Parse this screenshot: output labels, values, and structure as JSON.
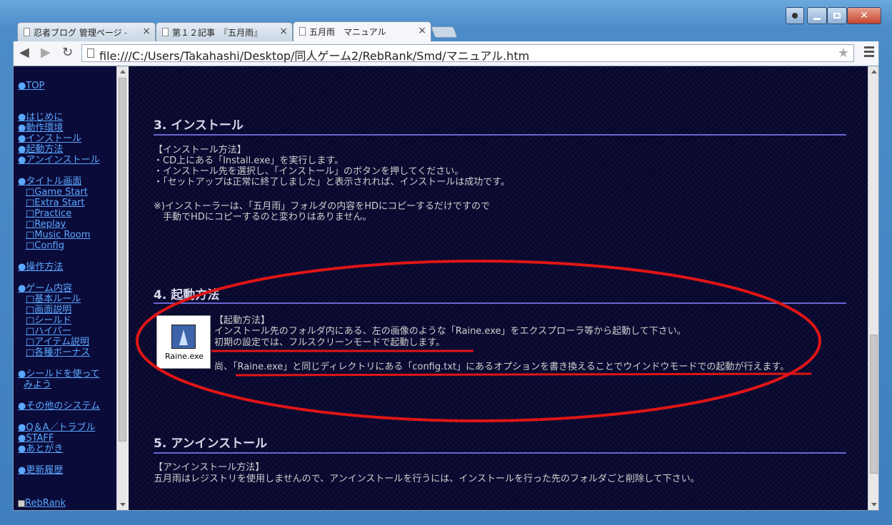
{
  "tabs": [
    {
      "label": "忍者ブログ 管理ページ - "
    },
    {
      "label": "第１２記事　『五月雨』"
    },
    {
      "label": "五月雨　マニュアル"
    }
  ],
  "address": {
    "url": "file:///C:/Users/Takahashi/Desktop/同人ゲーム2/RebRank/Smd/マニュアル.htm"
  },
  "sidebar": {
    "top": "●TOP",
    "items": [
      "●はじめに",
      "●動作環境",
      "●インストール",
      "●起動方法",
      "●アンインストール",
      "●タイトル画面",
      "□Game Start",
      "□Extra Start",
      "□Practice",
      "□Replay",
      "□Music Room",
      "□Config",
      "●操作方法",
      "●ゲーム内容",
      "□基本ルール",
      "□画面説明",
      "□シールド",
      "□ハイパー",
      "□アイテム説明",
      "□各種ボーナス",
      "●シールドを使って",
      "みよう",
      "●その他のシステム",
      "●Q＆A／トラブル",
      "●STAFF",
      "●あとがき",
      "●更新履歴",
      "RebRank"
    ]
  },
  "sections": {
    "install": {
      "title": "3. インストール",
      "heading": "【インストール方法】",
      "lines": [
        "・CD上にある「Install.exe」を実行します。",
        "・インストール先を選択し、「インストール」のボタンを押してください。",
        "・「セットアップは正常に終了しました」と表示されれば、インストールは成功です。"
      ],
      "note1": "※)インストーラーは、「五月雨」フォルダの内容をHDにコピーするだけですので",
      "note2": "　手動でHDにコピーするのと変わりはありません。"
    },
    "launch": {
      "title": "4. 起動方法",
      "heading": "【起動方法】",
      "line1": "インストール先のフォルダ内にある、左の画像のような「Raine.exe」をエクスプローラ等から起動して下さい。",
      "line2": "初期の設定では、フルスクリーンモードで起動します。",
      "line3": "尚、「Raine.exe」と同じディレクトリにある「config.txt」にあるオプションを書き換えることでウインドウモードでの起動が行えます。",
      "icon_label": "Raine.exe"
    },
    "uninstall": {
      "title": "5. アンインストール",
      "heading": "【アンインストール方法】",
      "line1": "五月雨はレジストリを使用しませんので、アンインストールを行うには、インストールを行った先のフォルダごと削除して下さい。"
    }
  },
  "colors": {
    "annotation": "#e01515",
    "link": "#5aa8ff",
    "rule": "#6a66d0"
  }
}
